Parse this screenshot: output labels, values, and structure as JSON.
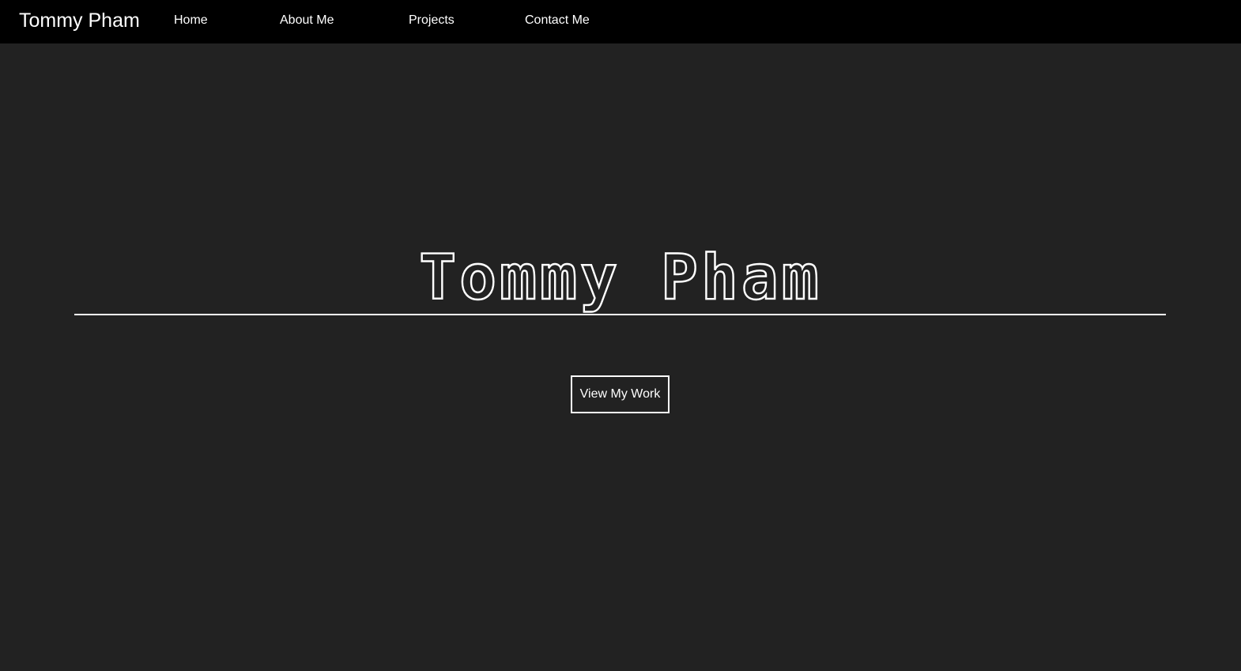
{
  "navbar": {
    "brand": "Tommy Pham",
    "links": [
      {
        "label": "Home"
      },
      {
        "label": "About Me"
      },
      {
        "label": "Projects"
      },
      {
        "label": "Contact Me"
      }
    ]
  },
  "hero": {
    "title": "Tommy Pham",
    "button_label": "View My Work"
  },
  "colors": {
    "background": "#222222",
    "navbar": "#000000",
    "text": "#ffffff"
  }
}
